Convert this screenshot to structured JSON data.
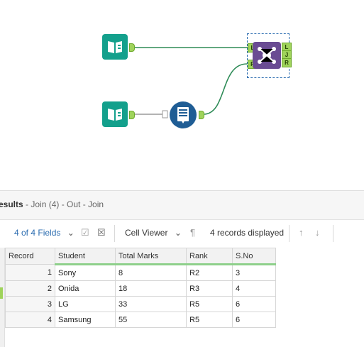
{
  "canvas": {
    "tools": [
      {
        "name": "input-data-1",
        "icon": "book-icon"
      },
      {
        "name": "input-data-2",
        "icon": "book-icon"
      },
      {
        "name": "sort",
        "icon": "sort-icon"
      },
      {
        "name": "join",
        "icon": "join-icon"
      }
    ],
    "join_anchors_left": [
      "L",
      "R"
    ],
    "join_anchors_right": [
      "L",
      "J",
      "R"
    ],
    "colors": {
      "input_tool": "#13a08c",
      "join_tool": "#6a4c93",
      "sort_tool": "#1f5d95",
      "connection": "#2e8b57",
      "anchor": "#9fd35b"
    }
  },
  "results": {
    "title_bold": "esults",
    "title_sub": " - Join (4) - Out - Join",
    "toolbar": {
      "fields_label": "4 of 4 Fields",
      "viewer_label": "Cell Viewer",
      "records_label": "4 records displayed"
    },
    "columns": [
      "Record",
      "Student",
      "Total Marks",
      "Rank",
      "S.No"
    ],
    "rows": [
      [
        "1",
        "Sony",
        "8",
        "R2",
        "3"
      ],
      [
        "2",
        "Onida",
        "18",
        "R3",
        "4"
      ],
      [
        "3",
        "LG",
        "33",
        "R5",
        "6"
      ],
      [
        "4",
        "Samsung",
        "55",
        "R5",
        "6"
      ]
    ]
  }
}
